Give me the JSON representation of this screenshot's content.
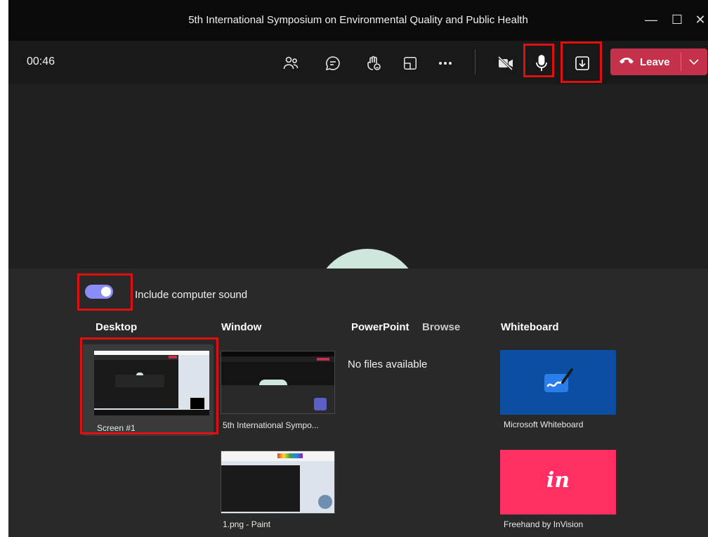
{
  "window": {
    "title": "5th International Symposium on Environmental Quality and Public Health",
    "controls": {
      "minimize": "—",
      "maximize": "☐",
      "close": "✕"
    }
  },
  "toolbar": {
    "timer": "00:46",
    "leave_label": "Leave",
    "icons": [
      "people-icon",
      "chat-icon",
      "raise-hand-icon",
      "rooms-icon",
      "more-icon",
      "camera-off-icon",
      "microphone-icon",
      "share-tray-icon",
      "leave-phone-icon",
      "chevron-down-icon"
    ]
  },
  "share_tray": {
    "include_sound_label": "Include computer sound",
    "include_sound_on": true,
    "headers": {
      "desktop": "Desktop",
      "window": "Window",
      "powerpoint": "PowerPoint",
      "browse": "Browse",
      "whiteboard": "Whiteboard"
    },
    "desktop": [
      {
        "label": "Screen #1"
      }
    ],
    "windows": [
      {
        "label": "5th International Sympo..."
      },
      {
        "label": "1.png - Paint"
      }
    ],
    "powerpoint_empty": "No files available",
    "whiteboards": [
      {
        "label": "Microsoft Whiteboard",
        "logo_text": ""
      },
      {
        "label": "Freehand by InVision",
        "logo_text": "in"
      }
    ]
  },
  "colors": {
    "accent": "#8b8cf8",
    "leave": "#c4314b",
    "highlight": "#e01010",
    "whiteboard_bg": "#0b4ea2",
    "invision_bg": "#ff2e63"
  }
}
